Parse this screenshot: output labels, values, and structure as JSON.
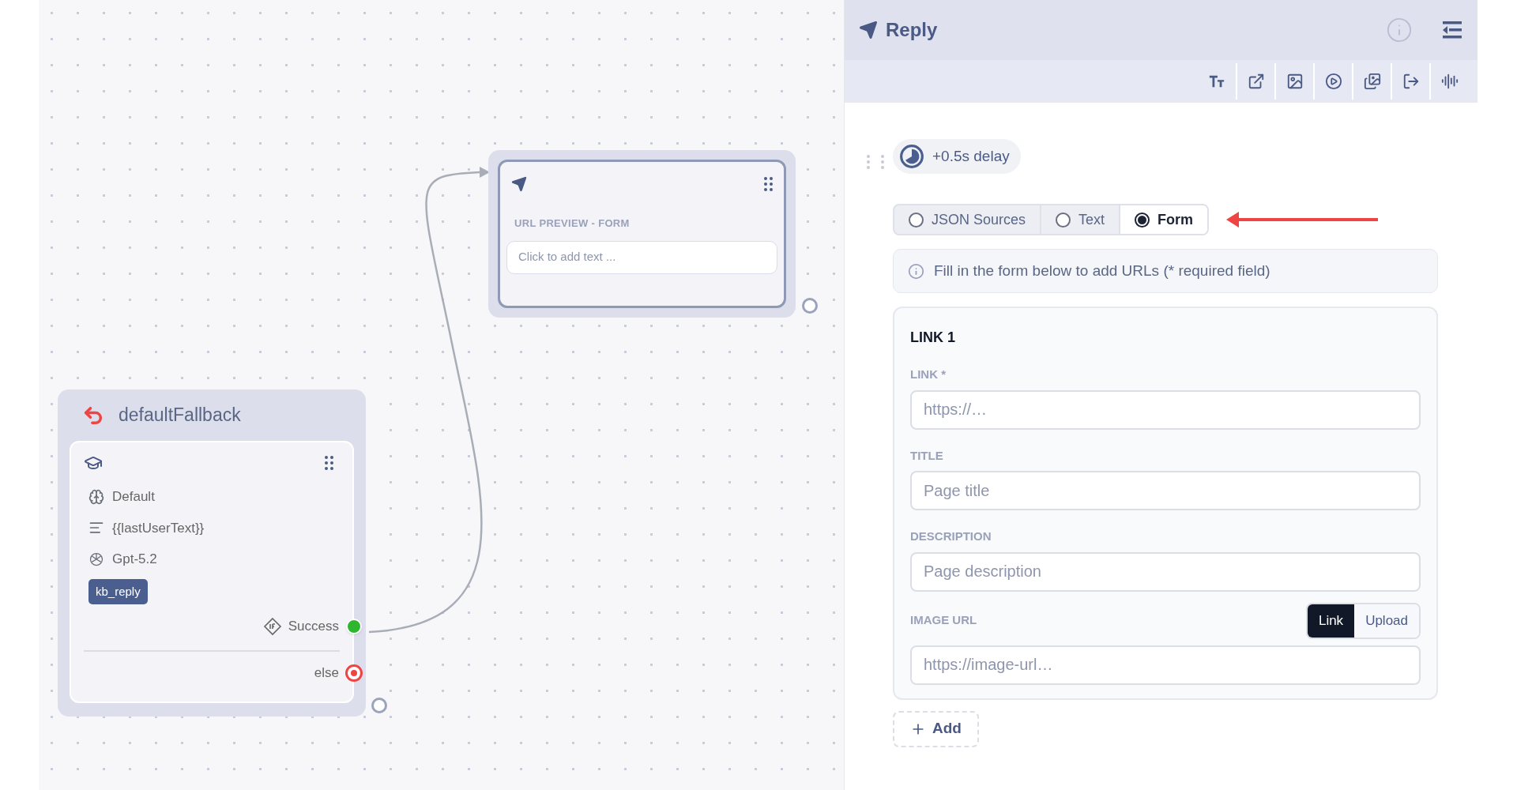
{
  "canvas": {
    "url_node": {
      "title": "URL PREVIEW - FORM",
      "placeholder": "Click to add text ..."
    },
    "fallback_node": {
      "title": "defaultFallback",
      "rows": [
        {
          "kind": "brain",
          "text": "Default"
        },
        {
          "kind": "lines",
          "text": "{{lastUserText}}"
        },
        {
          "kind": "model",
          "text": "Gpt-5.2"
        }
      ],
      "tag": "kb_reply",
      "outputs": [
        {
          "kind": "success",
          "label": "Success"
        },
        {
          "kind": "else",
          "label": "else"
        }
      ]
    }
  },
  "panel": {
    "title": "Reply",
    "delay": "+0.5s delay",
    "modes": [
      {
        "label": "JSON Sources",
        "selected": false
      },
      {
        "label": "Text",
        "selected": false
      },
      {
        "label": "Form",
        "selected": true
      }
    ],
    "hint": "Fill in the form below to add URLs (* required field)",
    "links": [
      {
        "heading": "LINK 1",
        "fields": [
          {
            "label": "LINK *",
            "placeholder": "https://…"
          },
          {
            "label": "TITLE",
            "placeholder": "Page title"
          },
          {
            "label": "DESCRIPTION",
            "placeholder": "Page description"
          }
        ],
        "image": {
          "label": "IMAGE URL",
          "placeholder": "https://image-url…",
          "sources": [
            {
              "label": "Link",
              "selected": true
            },
            {
              "label": "Upload",
              "selected": false
            }
          ]
        }
      }
    ],
    "add_button": "Add"
  }
}
